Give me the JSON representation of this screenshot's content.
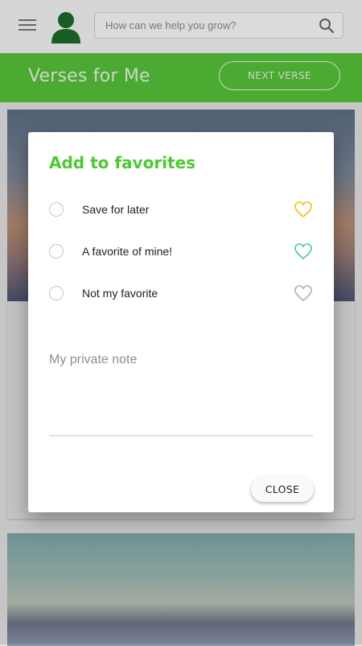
{
  "topbar": {
    "search_placeholder": "How can we help you grow?",
    "menu_icon": "hamburger-menu-icon",
    "avatar_icon": "user-avatar-icon",
    "search_icon": "search-icon"
  },
  "header": {
    "title": "Verses for Me",
    "next_button": "NEXT VERSE",
    "color": "#56c23a"
  },
  "dialog": {
    "title": "Add to favorites",
    "options": [
      {
        "label": "Save for later",
        "icon": "heart-icon",
        "heart_color": "#f5c12e"
      },
      {
        "label": "A favorite of mine!",
        "icon": "heart-icon",
        "heart_color": "#5ccca4"
      },
      {
        "label": "Not my favorite",
        "icon": "heart-icon",
        "heart_color": "#b7b7b7"
      }
    ],
    "note_label": "My private note",
    "close_button": "CLOSE",
    "title_color": "#4cc930"
  }
}
